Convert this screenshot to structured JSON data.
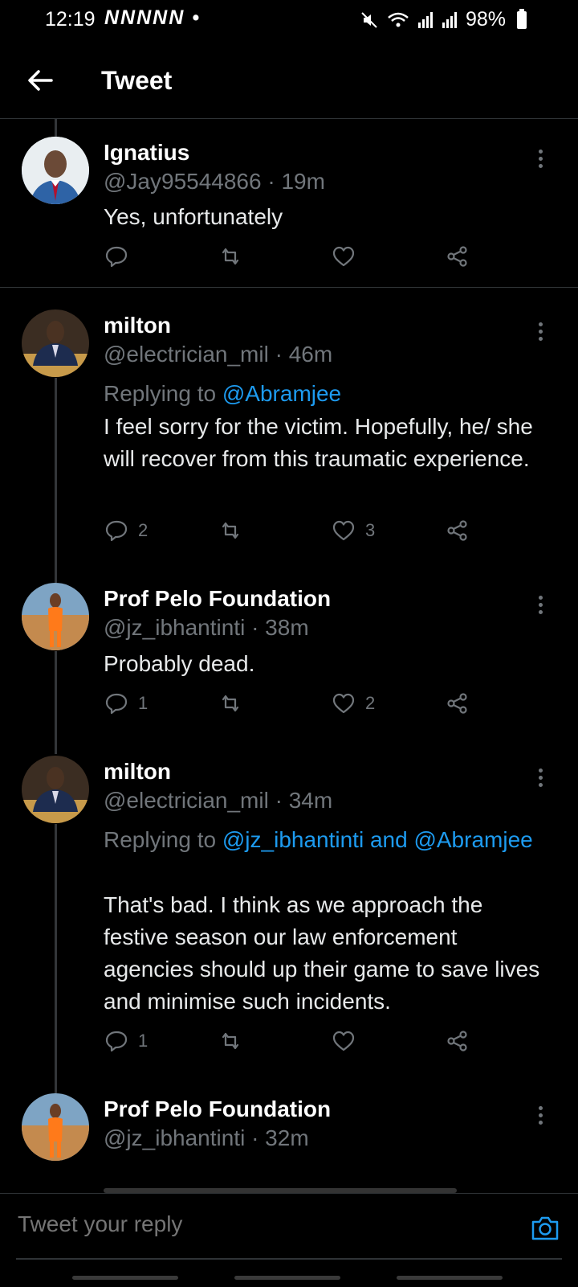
{
  "status": {
    "time": "12:19",
    "notif_icons": "NNNNN",
    "dot": "•",
    "battery": "98%"
  },
  "header": {
    "title": "Tweet"
  },
  "tweets": [
    {
      "name": "Ignatius",
      "handle": "@Jay95544866 · 19m",
      "text": "Yes, unfortunately",
      "reply_count": "",
      "like_count": ""
    },
    {
      "name": "milton",
      "handle": "@electrician_mil · 46m",
      "replying_prefix": "Replying to ",
      "replying_to": "@Abramjee",
      "text": "I feel sorry for the victim. Hopefully, he/ she will recover from this traumatic experience.",
      "reply_count": "2",
      "like_count": "3"
    },
    {
      "name": "Prof Pelo Foundation",
      "handle": "@jz_ibhantinti · 38m",
      "text": "Probably dead.",
      "reply_count": "1",
      "like_count": "2"
    },
    {
      "name": "milton",
      "handle": "@electrician_mil · 34m",
      "replying_prefix": "Replying to ",
      "replying_to": "@jz_ibhantinti and @Abramjee",
      "text": "That's bad. I think as we approach the festive season our law enforcement agencies should up their game to save lives and minimise such incidents.",
      "reply_count": "1",
      "like_count": ""
    },
    {
      "name": "Prof Pelo Foundation",
      "handle": "@jz_ibhantinti · 32m"
    }
  ],
  "reply_bar": {
    "placeholder": "Tweet your reply"
  },
  "colors": {
    "accent": "#1d9bf0",
    "muted": "#71767b",
    "background": "#000000"
  }
}
